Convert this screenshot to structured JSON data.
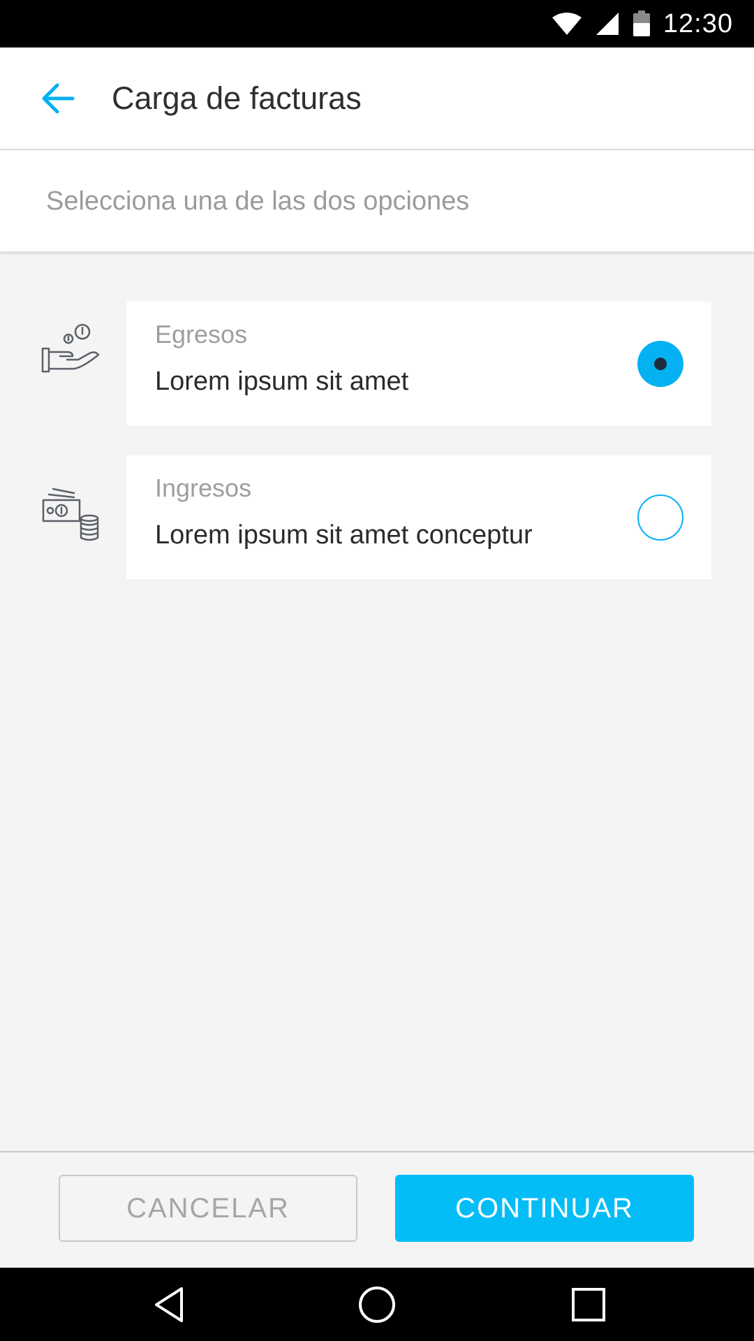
{
  "status_bar": {
    "time": "12:30",
    "icons": [
      "wifi-icon",
      "signal-icon",
      "battery-icon"
    ]
  },
  "app_bar": {
    "back_icon": "arrow-left-icon",
    "title": "Carga de facturas"
  },
  "subheader": {
    "text": "Selecciona una de las dos opciones"
  },
  "options": [
    {
      "icon": "hand-coins-icon",
      "label": "Egresos",
      "description": "Lorem ipsum sit amet",
      "selected": true
    },
    {
      "icon": "cash-coins-icon",
      "label": "Ingresos",
      "description": "Lorem ipsum sit amet conceptur",
      "selected": false
    }
  ],
  "actions": {
    "cancel_label": "CANCELAR",
    "continue_label": "CONTINUAR"
  },
  "nav_bar": {
    "icons": [
      "nav-back-icon",
      "nav-home-icon",
      "nav-recents-icon"
    ]
  },
  "colors": {
    "accent": "#04b1f1",
    "button_primary": "#04bdf7",
    "radio_dot": "#1f2d3d",
    "background": "#f4f4f4"
  }
}
